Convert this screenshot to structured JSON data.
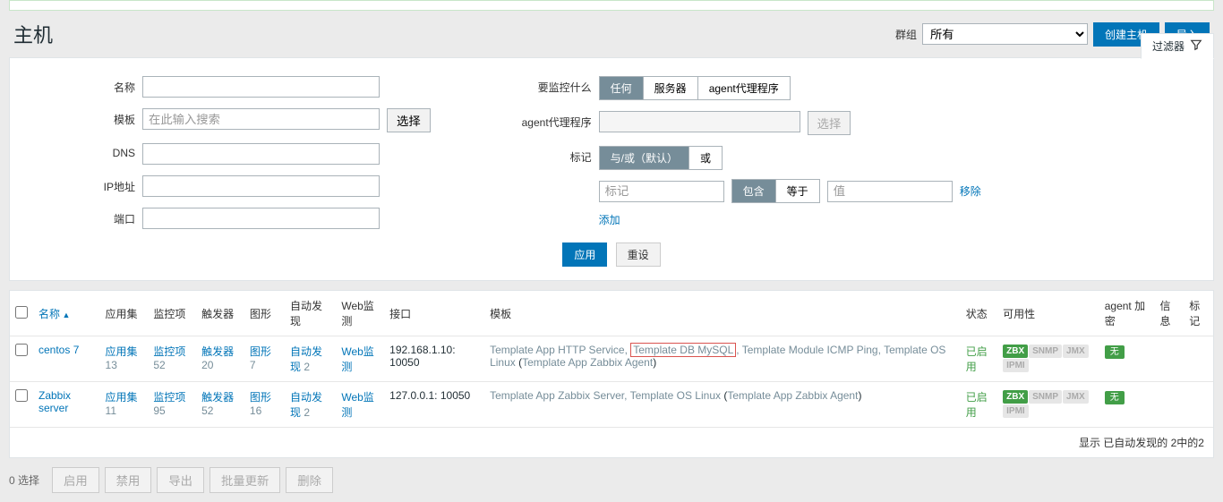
{
  "page": {
    "title": "主机"
  },
  "header": {
    "group_label": "群组",
    "group_value": "所有",
    "create_btn": "创建主机",
    "import_btn": "导入"
  },
  "filter": {
    "tab_label": "过滤器",
    "labels": {
      "name": "名称",
      "template": "模板",
      "dns": "DNS",
      "ip": "IP地址",
      "port": "端口",
      "monitored": "要监控什么",
      "agent_proxy": "agent代理程序",
      "tags": "标记"
    },
    "template_placeholder": "在此输入搜索",
    "select_btn": "选择",
    "monitored_opts": {
      "any": "任何",
      "server": "服务器",
      "proxy": "agent代理程序"
    },
    "tag_mode": {
      "andor": "与/或（默认）",
      "or": "或"
    },
    "tag_row": {
      "tag_placeholder": "标记",
      "contains": "包含",
      "equals": "等于",
      "value_placeholder": "值",
      "remove": "移除"
    },
    "add_link": "添加",
    "apply_btn": "应用",
    "reset_btn": "重设"
  },
  "table": {
    "headers": {
      "name": "名称",
      "apps": "应用集",
      "items": "监控项",
      "triggers": "触发器",
      "graphs": "图形",
      "discovery": "自动发现",
      "web": "Web监测",
      "interface": "接口",
      "templates": "模板",
      "status": "状态",
      "availability": "可用性",
      "agent_encrypt": "agent 加密",
      "info": "信息",
      "tags": "标记"
    },
    "rows": [
      {
        "name": "centos 7",
        "apps": "应用集",
        "apps_n": "13",
        "items": "监控项",
        "items_n": "52",
        "triggers": "触发器",
        "triggers_n": "20",
        "graphs": "图形",
        "graphs_n": "7",
        "discovery": "自动发现",
        "discovery_n": "2",
        "web": "Web监测",
        "interface": "192.168.1.10: 10050",
        "tpl1": "Template App HTTP Service",
        "tpl2": "Template DB MySQL",
        "tpl3": "Template Module ICMP Ping",
        "tpl4": "Template OS Linux",
        "tpl4_sub": "Template App Zabbix Agent",
        "status": "已启用",
        "encrypt": "无"
      },
      {
        "name": "Zabbix server",
        "apps": "应用集",
        "apps_n": "11",
        "items": "监控项",
        "items_n": "95",
        "triggers": "触发器",
        "triggers_n": "52",
        "graphs": "图形",
        "graphs_n": "16",
        "discovery": "自动发现",
        "discovery_n": "2",
        "web": "Web监测",
        "interface": "127.0.0.1: 10050",
        "tpl1": "Template App Zabbix Server",
        "tpl2": "Template OS Linux",
        "tpl2_sub": "Template App Zabbix Agent",
        "status": "已启用",
        "encrypt": "无"
      }
    ],
    "footer": "显示 已自动发现的 2中的2"
  },
  "bulk": {
    "selected": "0 选择",
    "enable": "启用",
    "disable": "禁用",
    "export": "导出",
    "massupdate": "批量更新",
    "delete": "删除"
  },
  "avail": {
    "zbx": "ZBX",
    "snmp": "SNMP",
    "jmx": "JMX",
    "ipmi": "IPMI"
  }
}
